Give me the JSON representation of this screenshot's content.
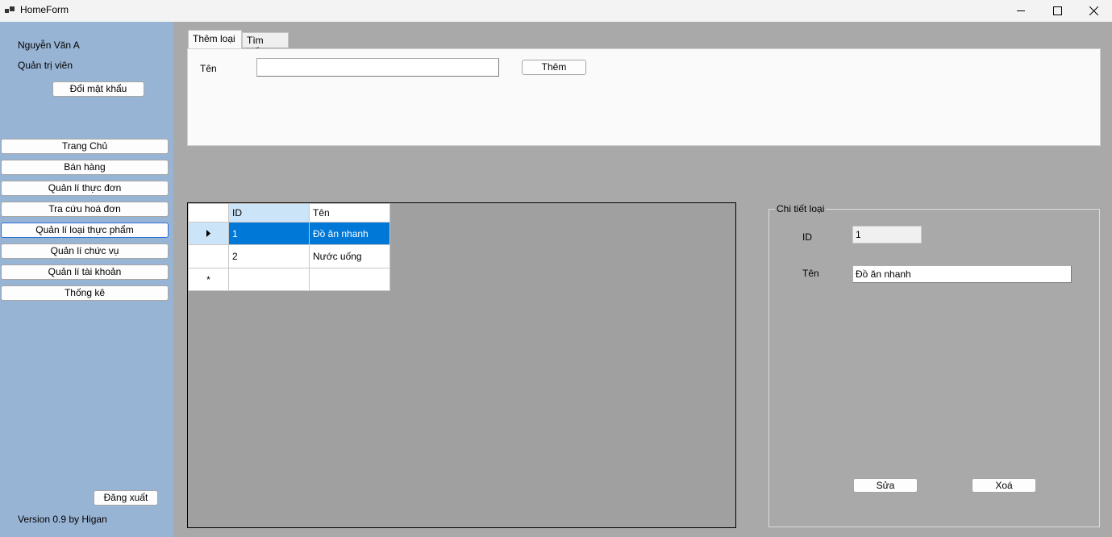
{
  "window": {
    "title": "HomeForm"
  },
  "sidebar": {
    "user_name": "Nguyễn Văn A",
    "role": "Quản trị viên",
    "change_password": "Đổi mật khẩu",
    "nav": [
      "Trang Chủ",
      "Bán hàng",
      "Quản lí thực đơn",
      "Tra cứu hoá đơn",
      "Quản lí loại thực phẩm",
      "Quản lí chức vụ",
      "Quản lí tài khoản",
      "Thống kê"
    ],
    "logout": "Đăng xuất",
    "version": "Version 0.9 by Higan"
  },
  "tabs": [
    {
      "label": "Thêm loại",
      "active": true
    },
    {
      "label": "Tìm kiếm",
      "active": false
    }
  ],
  "add_panel": {
    "name_label": "Tên",
    "name_value": "",
    "add_button": "Thêm"
  },
  "grid": {
    "columns": [
      "ID",
      "Tên"
    ],
    "rows": [
      {
        "id": "1",
        "name": "Đồ ăn nhanh"
      },
      {
        "id": "2",
        "name": "Nước uống"
      }
    ],
    "new_row_marker": "*"
  },
  "detail": {
    "legend": "Chi tiết loại",
    "id_label": "ID",
    "id_value": "1",
    "name_label": "Tên",
    "name_value": "Đồ ăn nhanh",
    "edit_button": "Sửa",
    "delete_button": "Xoá"
  }
}
